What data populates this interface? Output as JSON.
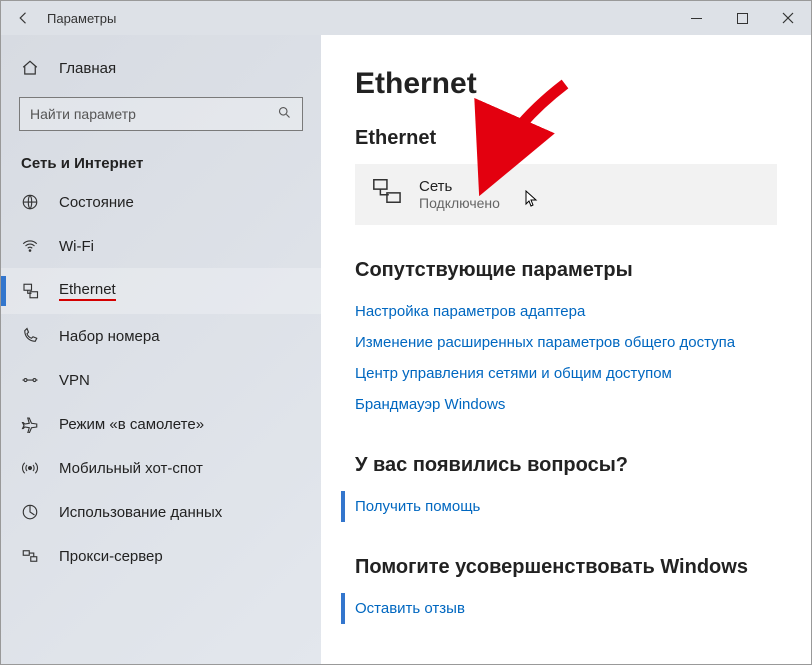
{
  "window": {
    "title": "Параметры"
  },
  "sidebar": {
    "home": "Главная",
    "search_placeholder": "Найти параметр",
    "category": "Сеть и Интернет",
    "items": [
      {
        "label": "Состояние"
      },
      {
        "label": "Wi-Fi"
      },
      {
        "label": "Ethernet"
      },
      {
        "label": "Набор номера"
      },
      {
        "label": "VPN"
      },
      {
        "label": "Режим «в самолете»"
      },
      {
        "label": "Мобильный хот-спот"
      },
      {
        "label": "Использование данных"
      },
      {
        "label": "Прокси-сервер"
      }
    ]
  },
  "main": {
    "title": "Ethernet",
    "section_network": "Ethernet",
    "network": {
      "name": "Сеть",
      "status": "Подключено"
    },
    "related_heading": "Сопутствующие параметры",
    "links": [
      "Настройка параметров адаптера",
      "Изменение расширенных параметров общего доступа",
      "Центр управления сетями и общим доступом",
      "Брандмауэр Windows"
    ],
    "help_heading": "У вас появились вопросы?",
    "help_link": "Получить помощь",
    "feedback_heading": "Помогите усовершенствовать Windows",
    "feedback_link": "Оставить отзыв"
  }
}
